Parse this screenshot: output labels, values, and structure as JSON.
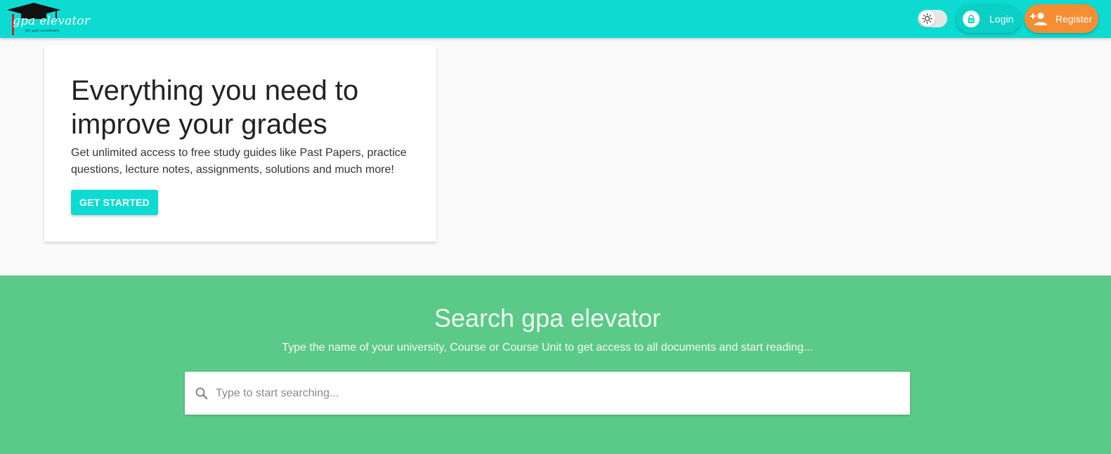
{
  "header": {
    "logo_text": "gpa elevator",
    "logo_tagline": "for your excellence",
    "login_label": "Login",
    "register_label": "Register",
    "brand_color": "#0ddbd1",
    "register_color": "#f58e33"
  },
  "hero": {
    "title": "Everything you need to improve your grades",
    "description": "Get unlimited access to free study guides like Past Papers, practice questions, lecture notes, assignments, solutions and much more!",
    "cta_label": "GET STARTED"
  },
  "search": {
    "title": "Search gpa elevator",
    "subtitle": "Type the name of your university, Course or Course Unit to get access to all documents and start reading...",
    "placeholder": "Type to start searching...",
    "section_color": "#5bc987"
  },
  "icons": {
    "theme_toggle": "sun-icon",
    "login": "lock-icon",
    "register": "person-add-icon",
    "search": "search-icon",
    "logo": "graduation-cap-icon"
  }
}
